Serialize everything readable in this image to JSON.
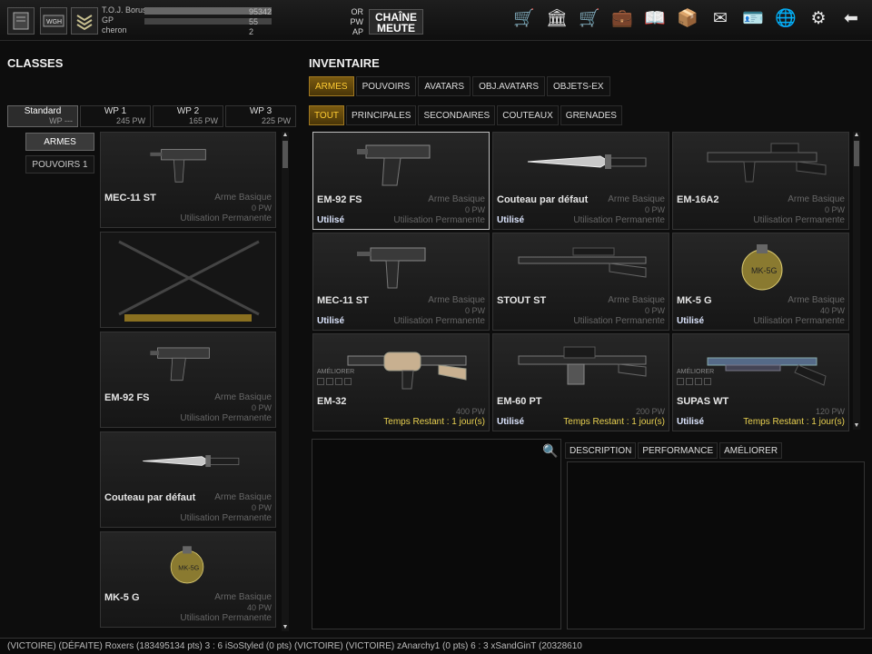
{
  "top_bar": {
    "player": {
      "name": "T.O.J. Borus",
      "rank_label": "GP",
      "clan_name": "cheron"
    },
    "currency": [
      {
        "label": "OR",
        "value": "95342"
      },
      {
        "label": "PW",
        "value": "55"
      },
      {
        "label": "AP",
        "value": "2"
      }
    ],
    "clan_button": {
      "line1": "CHAÎNE",
      "line2": "MEUTE"
    },
    "icons": [
      {
        "name": "shop-basket-icon",
        "glyph": "🛒"
      },
      {
        "name": "bank-icon",
        "glyph": "🏛"
      },
      {
        "name": "cart-icon",
        "glyph": "🛒"
      },
      {
        "name": "inventory-bag-icon",
        "glyph": "💼"
      },
      {
        "name": "book-icon",
        "glyph": "📖"
      },
      {
        "name": "box-icon",
        "glyph": "📦"
      },
      {
        "name": "mail-icon",
        "glyph": "✉"
      },
      {
        "name": "id-card-icon",
        "glyph": "🪪"
      },
      {
        "name": "globe-icon",
        "glyph": "🌐"
      },
      {
        "name": "settings-gear-icon",
        "glyph": "⚙"
      },
      {
        "name": "back-arrow-icon",
        "glyph": "⬅"
      }
    ]
  },
  "classes": {
    "title": "CLASSES",
    "tabs": [
      {
        "label": "Standard",
        "sub": "WP ---"
      },
      {
        "label": "WP 1",
        "sub": "245 PW"
      },
      {
        "label": "WP 2",
        "sub": "165 PW"
      },
      {
        "label": "WP 3",
        "sub": "225 PW"
      }
    ],
    "side_buttons": [
      "ARMES",
      "POUVOIRS 1"
    ],
    "items": [
      {
        "name": "MEC-11 ST",
        "type": "Arme Basique",
        "pw": "0 PW",
        "usage": "Utilisation Permanente",
        "weapon": "smg"
      },
      {
        "name": "",
        "type": "",
        "pw": "",
        "usage": "",
        "weapon": "empty"
      },
      {
        "name": "EM-92 FS",
        "type": "Arme Basique",
        "pw": "0 PW",
        "usage": "Utilisation Permanente",
        "weapon": "pistol"
      },
      {
        "name": "Couteau par défaut",
        "type": "Arme Basique",
        "pw": "0 PW",
        "usage": "Utilisation Permanente",
        "weapon": "knife"
      },
      {
        "name": "MK-5 G",
        "type": "Arme Basique",
        "pw": "40 PW",
        "usage": "Utilisation Permanente",
        "weapon": "grenade"
      }
    ]
  },
  "inventory": {
    "title": "INVENTAIRE",
    "tabs": [
      "ARMES",
      "POUVOIRS",
      "AVATARS",
      "OBJ.AVATARS",
      "OBJETS-EX"
    ],
    "subtabs": [
      "TOUT",
      "PRINCIPALES",
      "SECONDAIRES",
      "COUTEAUX",
      "GRENADES"
    ],
    "items": [
      {
        "name": "EM-92 FS",
        "type": "Arme Basique",
        "pw": "0 PW",
        "status": "Utilisé",
        "usage": "Utilisation Permanente",
        "weapon": "pistol",
        "selected": true
      },
      {
        "name": "Couteau par défaut",
        "type": "Arme Basique",
        "pw": "0 PW",
        "status": "Utilisé",
        "usage": "Utilisation Permanente",
        "weapon": "knife"
      },
      {
        "name": "EM-16A2",
        "type": "Arme Basique",
        "pw": "0 PW",
        "status": "",
        "usage": "Utilisation Permanente",
        "weapon": "rifle"
      },
      {
        "name": "MEC-11 ST",
        "type": "Arme Basique",
        "pw": "0 PW",
        "status": "Utilisé",
        "usage": "Utilisation Permanente",
        "weapon": "smg"
      },
      {
        "name": "STOUT ST",
        "type": "Arme Basique",
        "pw": "0 PW",
        "status": "",
        "usage": "Utilisation Permanente",
        "weapon": "sniper"
      },
      {
        "name": "MK-5 G",
        "type": "Arme Basique",
        "pw": "40 PW",
        "status": "Utilisé",
        "usage": "Utilisation Permanente",
        "weapon": "grenade"
      },
      {
        "name": "EM-32",
        "type": "",
        "pw": "400 PW",
        "status": "",
        "time_left": "Temps Restant : 1 jour(s)",
        "upgrade": "AMÉLIORER",
        "weapon": "launcher"
      },
      {
        "name": "EM-60 PT",
        "type": "",
        "pw": "200 PW",
        "status": "Utilisé",
        "time_left": "Temps Restant : 1 jour(s)",
        "weapon": "mg"
      },
      {
        "name": "SUPAS WT",
        "type": "",
        "pw": "120 PW",
        "status": "Utilisé",
        "time_left": "Temps Restant : 1 jour(s)",
        "upgrade": "AMÉLIORER",
        "weapon": "shotgun"
      }
    ]
  },
  "detail_tabs": [
    "DESCRIPTION",
    "PERFORMANCE",
    "AMÉLIORER"
  ],
  "ticker": "(VICTOIRE)          (DÉFAITE) Roxers (183495134 pts) 3 : 6 iSoStyled (0 pts) (VICTOIRE)                    (VICTOIRE) zAnarchy1 (0 pts) 6 : 3 xSandGinT (20328610"
}
